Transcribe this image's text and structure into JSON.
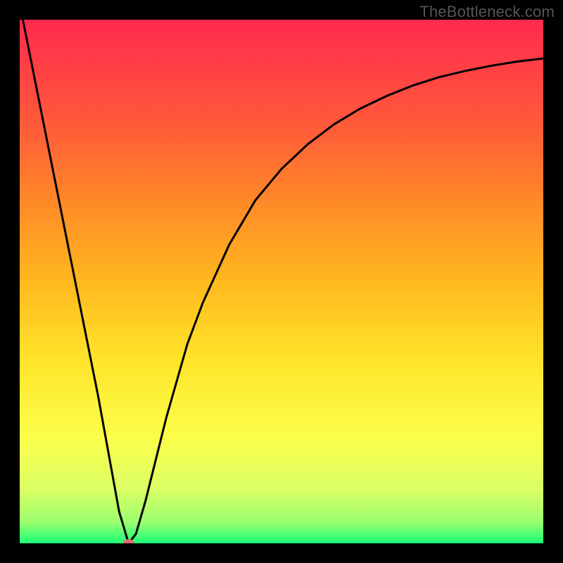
{
  "watermark": "TheBottleneck.com",
  "gradient_colors": {
    "top": "#ff2a4e",
    "c1": "#ff5a3a",
    "c2": "#ff8a28",
    "c3": "#ffb81e",
    "c4": "#ffe42a",
    "c5": "#fbff4a",
    "c6": "#d8ff66",
    "c7": "#9bff6e",
    "bottom": "#18ff77"
  },
  "marker_color": "#e46a6d",
  "curve_color": "#000000",
  "chart_data": {
    "type": "line",
    "title": "",
    "xlabel": "",
    "ylabel": "",
    "xlim": [
      0,
      100
    ],
    "ylim": [
      0,
      100
    ],
    "grid": false,
    "legend": false,
    "annotations": [
      "TheBottleneck.com"
    ],
    "marker": {
      "x": 20.8,
      "y": 0.0
    },
    "series": [
      {
        "name": "curve",
        "x": [
          0.6,
          5,
          10,
          15,
          19.0,
          20.8,
          22.2,
          24,
          26,
          28,
          30,
          32,
          35,
          40,
          45,
          50,
          55,
          60,
          65,
          70,
          75,
          80,
          85,
          90,
          95,
          100
        ],
        "values": [
          100,
          78,
          53,
          28,
          6.0,
          0.0,
          1.8,
          8,
          16,
          24,
          31,
          38,
          46,
          57,
          65.5,
          71.5,
          76.2,
          80,
          83,
          85.4,
          87.4,
          89,
          90.2,
          91.2,
          92,
          92.6
        ]
      }
    ]
  }
}
